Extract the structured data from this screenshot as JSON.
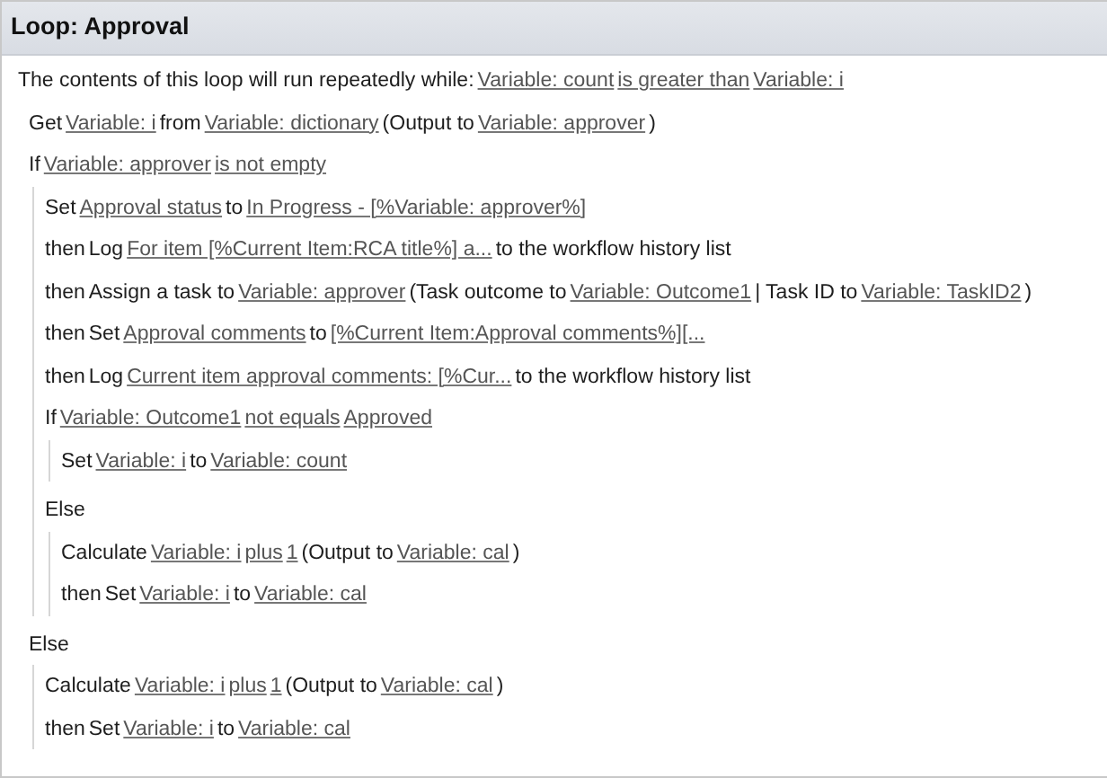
{
  "loop": {
    "title": "Loop: Approval",
    "condition": [
      {
        "kind": "text",
        "text": "The contents of this loop will run repeatedly while:"
      },
      {
        "kind": "link",
        "text": "Variable: count"
      },
      {
        "kind": "link",
        "text": "is greater than"
      },
      {
        "kind": "link",
        "text": "Variable: i"
      }
    ],
    "steps": [
      {
        "parts": [
          {
            "kind": "text",
            "text": "Get"
          },
          {
            "kind": "link",
            "text": "Variable: i"
          },
          {
            "kind": "text",
            "text": "from"
          },
          {
            "kind": "link",
            "text": "Variable: dictionary"
          },
          {
            "kind": "text",
            "text": "(Output to"
          },
          {
            "kind": "link",
            "text": "Variable: approver"
          },
          {
            "kind": "text",
            "text": ")"
          }
        ]
      },
      {
        "parts": [
          {
            "kind": "text",
            "text": "If"
          },
          {
            "kind": "link",
            "text": "Variable: approver"
          },
          {
            "kind": "link",
            "text": "is not empty"
          }
        ],
        "children": [
          {
            "parts": [
              {
                "kind": "text",
                "text": "Set"
              },
              {
                "kind": "link",
                "text": "Approval status"
              },
              {
                "kind": "text",
                "text": "to"
              },
              {
                "kind": "link",
                "text": "In Progress - [%Variable: approver%]"
              }
            ]
          },
          {
            "parts": [
              {
                "kind": "text",
                "text": "then"
              },
              {
                "kind": "text",
                "text": "Log"
              },
              {
                "kind": "link",
                "text": "For item [%Current Item:RCA title%] a..."
              },
              {
                "kind": "text",
                "text": "to the workflow history list"
              }
            ]
          },
          {
            "parts": [
              {
                "kind": "text",
                "text": "then"
              },
              {
                "kind": "text",
                "text": "Assign a task to"
              },
              {
                "kind": "link",
                "text": "Variable: approver"
              },
              {
                "kind": "text",
                "text": "(Task outcome to"
              },
              {
                "kind": "link",
                "text": "Variable: Outcome1"
              },
              {
                "kind": "text",
                "text": "| Task ID to"
              },
              {
                "kind": "link",
                "text": "Variable: TaskID2"
              },
              {
                "kind": "text",
                "text": ")"
              }
            ]
          },
          {
            "parts": [
              {
                "kind": "text",
                "text": "then"
              },
              {
                "kind": "text",
                "text": "Set"
              },
              {
                "kind": "link",
                "text": "Approval comments"
              },
              {
                "kind": "text",
                "text": "to"
              },
              {
                "kind": "link",
                "text": "[%Current Item:Approval comments%][..."
              }
            ]
          },
          {
            "parts": [
              {
                "kind": "text",
                "text": "then"
              },
              {
                "kind": "text",
                "text": "Log"
              },
              {
                "kind": "link",
                "text": "Current item approval comments: [%Cur..."
              },
              {
                "kind": "text",
                "text": "to the workflow history list"
              }
            ]
          },
          {
            "parts": [
              {
                "kind": "text",
                "text": "If"
              },
              {
                "kind": "link",
                "text": "Variable: Outcome1"
              },
              {
                "kind": "link",
                "text": "not equals"
              },
              {
                "kind": "link",
                "text": "Approved"
              }
            ],
            "children": [
              {
                "parts": [
                  {
                    "kind": "text",
                    "text": "Set"
                  },
                  {
                    "kind": "link",
                    "text": "Variable: i"
                  },
                  {
                    "kind": "text",
                    "text": "to"
                  },
                  {
                    "kind": "link",
                    "text": "Variable: count"
                  }
                ]
              }
            ]
          },
          {
            "parts": [
              {
                "kind": "text",
                "text": "Else"
              }
            ],
            "children": [
              {
                "parts": [
                  {
                    "kind": "text",
                    "text": "Calculate"
                  },
                  {
                    "kind": "link",
                    "text": "Variable: i"
                  },
                  {
                    "kind": "link",
                    "text": "plus"
                  },
                  {
                    "kind": "link",
                    "text": "1"
                  },
                  {
                    "kind": "text",
                    "text": "(Output to"
                  },
                  {
                    "kind": "link",
                    "text": "Variable: cal"
                  },
                  {
                    "kind": "text",
                    "text": ")"
                  }
                ]
              },
              {
                "parts": [
                  {
                    "kind": "text",
                    "text": "then"
                  },
                  {
                    "kind": "text",
                    "text": "Set"
                  },
                  {
                    "kind": "link",
                    "text": "Variable: i"
                  },
                  {
                    "kind": "text",
                    "text": "to"
                  },
                  {
                    "kind": "link",
                    "text": "Variable: cal"
                  }
                ]
              }
            ]
          }
        ]
      },
      {
        "parts": [
          {
            "kind": "text",
            "text": "Else"
          }
        ],
        "children": [
          {
            "parts": [
              {
                "kind": "text",
                "text": "Calculate"
              },
              {
                "kind": "link",
                "text": "Variable: i"
              },
              {
                "kind": "link",
                "text": "plus"
              },
              {
                "kind": "link",
                "text": "1"
              },
              {
                "kind": "text",
                "text": "(Output to"
              },
              {
                "kind": "link",
                "text": "Variable: cal"
              },
              {
                "kind": "text",
                "text": ")"
              }
            ]
          },
          {
            "parts": [
              {
                "kind": "text",
                "text": "then"
              },
              {
                "kind": "text",
                "text": "Set"
              },
              {
                "kind": "link",
                "text": "Variable: i"
              },
              {
                "kind": "text",
                "text": "to"
              },
              {
                "kind": "link",
                "text": "Variable: cal"
              }
            ]
          }
        ]
      }
    ]
  }
}
